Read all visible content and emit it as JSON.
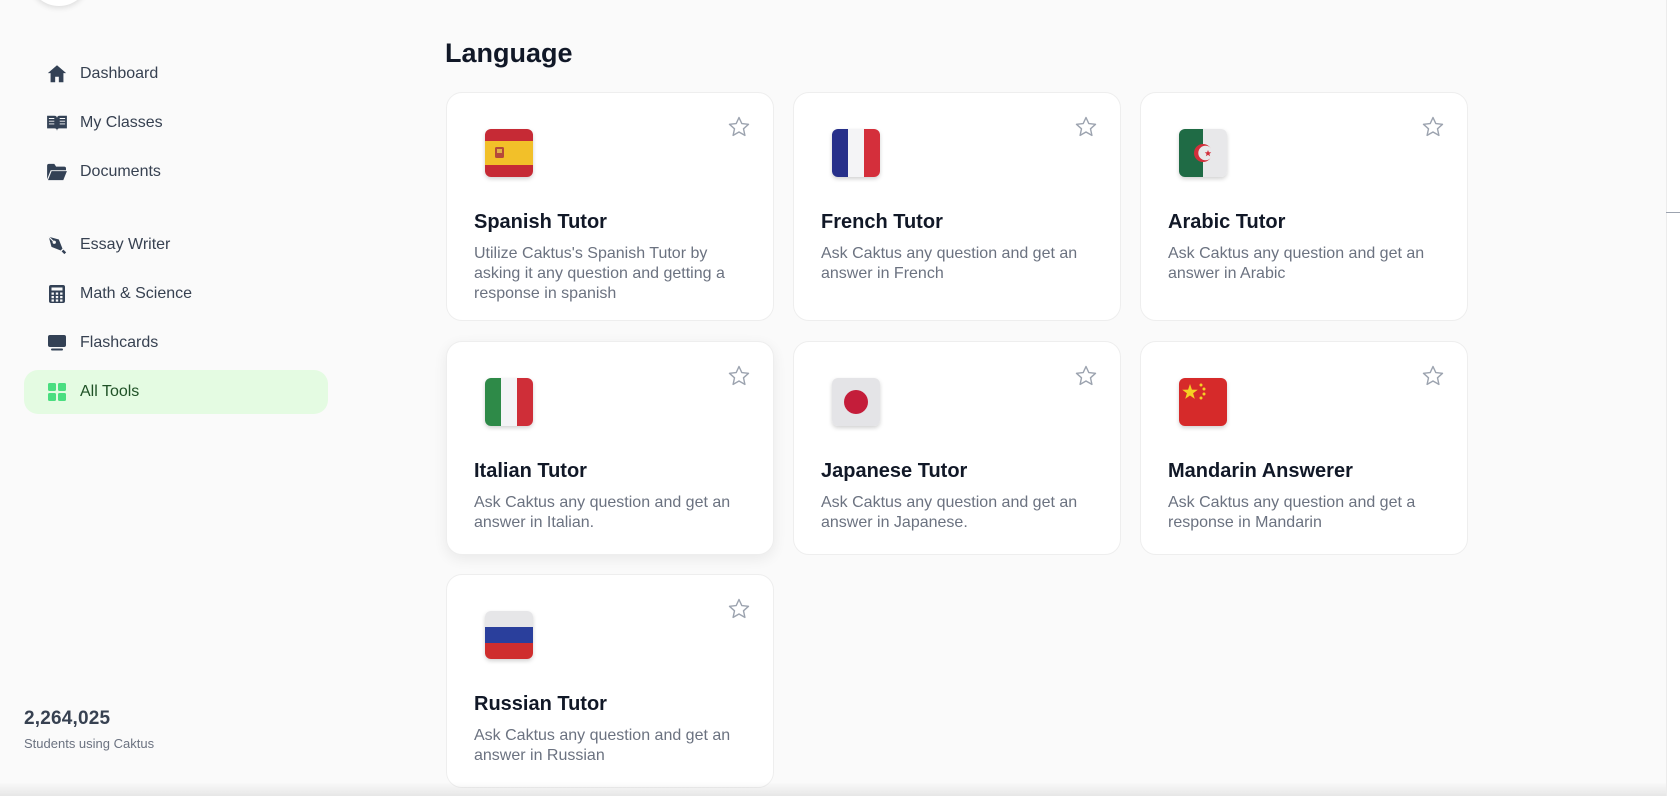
{
  "sidebar": {
    "items": [
      {
        "label": "Dashboard",
        "icon": "home-icon"
      },
      {
        "label": "My Classes",
        "icon": "book-icon"
      },
      {
        "label": "Documents",
        "icon": "folder-icon"
      },
      {
        "label": "Essay Writer",
        "icon": "pen-icon"
      },
      {
        "label": "Math & Science",
        "icon": "calculator-icon"
      },
      {
        "label": "Flashcards",
        "icon": "flashcard-icon"
      },
      {
        "label": "All Tools",
        "icon": "grid-icon",
        "active": true
      }
    ],
    "stats": {
      "count": "2,264,025",
      "caption": "Students using Caktus"
    }
  },
  "main": {
    "section_title": "Language",
    "cards": [
      {
        "title": "Spanish Tutor",
        "description": "Utilize Caktus's Spanish Tutor by asking it any question and getting a response in spanish",
        "flag": "spain-flag-icon"
      },
      {
        "title": "French Tutor",
        "description": "Ask Caktus any question and get an answer in French",
        "flag": "france-flag-icon"
      },
      {
        "title": "Arabic Tutor",
        "description": "Ask Caktus any question and get an answer in Arabic",
        "flag": "algeria-flag-icon"
      },
      {
        "title": "Italian Tutor",
        "description": "Ask Caktus any question and get an answer in Italian.",
        "flag": "italy-flag-icon"
      },
      {
        "title": "Japanese Tutor",
        "description": "Ask Caktus any question and get an answer in Japanese.",
        "flag": "japan-flag-icon"
      },
      {
        "title": "Mandarin Answerer",
        "description": "Ask Caktus any question and get a response in Mandarin",
        "flag": "china-flag-icon"
      },
      {
        "title": "Russian Tutor",
        "description": "Ask Caktus any question and get an answer in Russian",
        "flag": "russia-flag-icon"
      }
    ]
  },
  "colors": {
    "active_bg": "#e4fbe2",
    "active_icon": "#4ade80",
    "nav_icon": "#334155",
    "star_outline": "#9ca3af"
  }
}
